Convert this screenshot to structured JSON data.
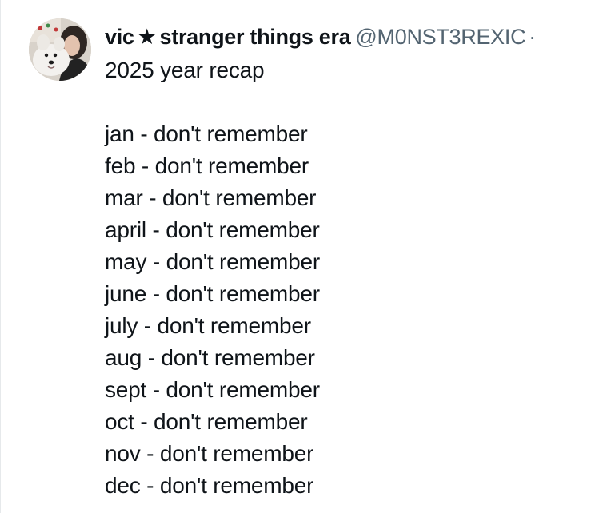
{
  "tweet": {
    "author": {
      "name_prefix": "vic",
      "star": "★",
      "name_suffix": "stranger things era",
      "handle": "@M0NST3REXIC",
      "separator": "·",
      "avatar_icon": "profile-photo-avatar"
    },
    "text": {
      "first_line": "2025 year recap",
      "months": [
        "jan - don't remember",
        "feb - don't remember",
        "mar - don't remember",
        "april - don't remember",
        "may - don't remember",
        "june - don't remember",
        "july - don't remember",
        "aug - don't remember",
        "sept - don't remember",
        "oct - don't remember",
        "nov - don't remember",
        "dec - don't remember"
      ]
    }
  },
  "colors": {
    "text_primary": "#0f1419",
    "text_secondary": "#536471",
    "border": "#e6e9eb",
    "background": "#ffffff"
  }
}
